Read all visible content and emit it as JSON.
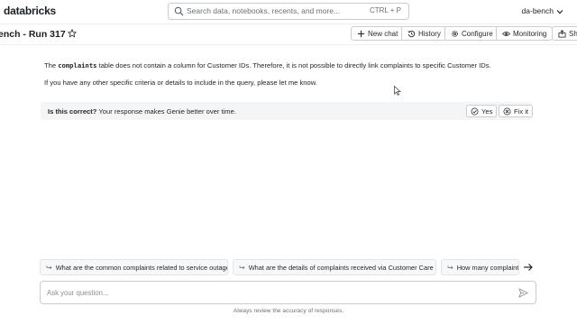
{
  "app": {
    "logo_text": "databricks",
    "workspace": "da-bench"
  },
  "search": {
    "placeholder": "Search data, notebooks, recents, and more...",
    "shortcut": "CTRL + P"
  },
  "title": {
    "text": "ench - Run 317"
  },
  "toolbar": {
    "new_chat": "New chat",
    "history": "History",
    "configure": "Configure",
    "monitoring": "Monitoring",
    "share": "Sha"
  },
  "message": {
    "line1_prefix": "The ",
    "line1_code": "complaints",
    "line1_suffix": " table does not contain a column for Customer IDs. Therefore, it is not possible to directly link complaints to specific Customer IDs.",
    "line2": "If you have any other specific criteria or details to include in the query, please let me know."
  },
  "feedback": {
    "question": "Is this correct?",
    "hint": " Your response makes Genie better over time.",
    "yes_label": "Yes",
    "fix_label": "Fix it"
  },
  "suggestions": [
    {
      "label": "What are the common complaints related to service outages?"
    },
    {
      "label": "What are the details of complaints received via Customer Care Call?"
    },
    {
      "label": "How many complaints"
    }
  ],
  "ask": {
    "placeholder": "Ask your question..."
  },
  "disclaimer": "Always review the accuracy of responses.",
  "icons": {
    "search": "search-icon",
    "star": "star-icon",
    "plus": "plus-icon",
    "history": "history-icon",
    "configure": "gear-icon",
    "monitoring": "eye-icon",
    "share": "share-icon",
    "yes": "thumbs-up-icon",
    "fix": "wrench-icon",
    "suggestion_arrow": "return-arrow-icon",
    "next": "arrow-right-icon",
    "send": "send-icon"
  }
}
